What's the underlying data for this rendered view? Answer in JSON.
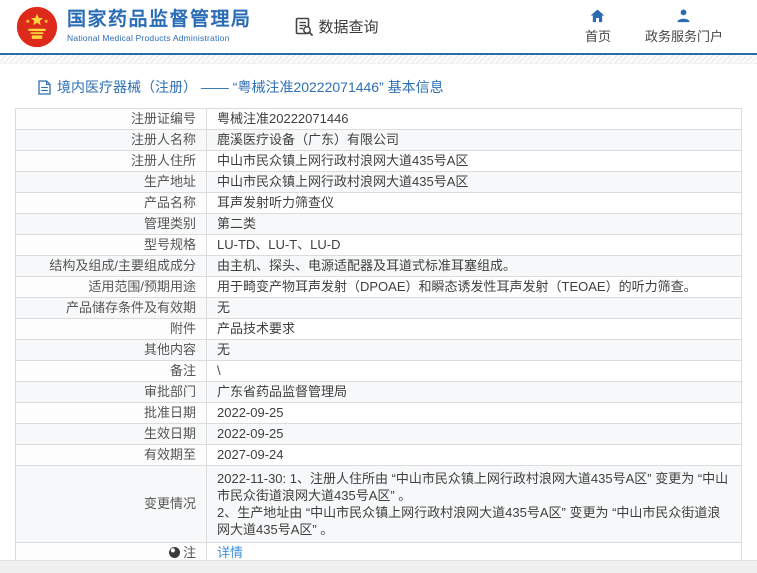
{
  "header": {
    "title_cn": "国家药品监督管理局",
    "title_en": "National Medical Products Administration",
    "data_query_label": "数据查询",
    "nav": {
      "home": "首页",
      "portal": "政务服务门户"
    }
  },
  "breadcrumb": {
    "text": "境内医疗器械（注册） —— “粤械注准20222071446” 基本信息"
  },
  "table": {
    "rows": [
      {
        "label": "注册证编号",
        "value": "粤械注准20222071446"
      },
      {
        "label": "注册人名称",
        "value": "鹿溪医疗设备（广东）有限公司"
      },
      {
        "label": "注册人住所",
        "value": "中山市民众镇上网行政村浪网大道435号A区"
      },
      {
        "label": "生产地址",
        "value": "中山市民众镇上网行政村浪网大道435号A区"
      },
      {
        "label": "产品名称",
        "value": "耳声发射听力筛查仪"
      },
      {
        "label": "管理类别",
        "value": "第二类"
      },
      {
        "label": "型号规格",
        "value": "LU-TD、LU-T、LU-D"
      },
      {
        "label": "结构及组成/主要组成成分",
        "value": "由主机、探头、电源适配器及耳道式标准耳塞组成。"
      },
      {
        "label": "适用范围/预期用途",
        "value": "用于畸变产物耳声发射（DPOAE）和瞬态诱发性耳声发射（TEOAE）的听力筛查。"
      },
      {
        "label": "产品储存条件及有效期",
        "value": "无"
      },
      {
        "label": "附件",
        "value": "产品技术要求"
      },
      {
        "label": "其他内容",
        "value": "无"
      },
      {
        "label": "备注",
        "value": "\\"
      },
      {
        "label": "审批部门",
        "value": "广东省药品监督管理局"
      },
      {
        "label": "批准日期",
        "value": "2022-09-25"
      },
      {
        "label": "生效日期",
        "value": "2022-09-25"
      },
      {
        "label": "有效期至",
        "value": "2027-09-24"
      },
      {
        "label": "变更情况",
        "multiline": true,
        "value": "2022-11-30: 1、注册人住所由 “中山市民众镇上网行政村浪网大道435号A区” 变更为 “中山市民众街道浪网大道435号A区” 。\n2、生产地址由 “中山市民众镇上网行政村浪网大道435号A区” 变更为 “中山市民众街道浪网大道435号A区” 。"
      },
      {
        "label": "注",
        "label_icon": "note-icon",
        "value": "详情",
        "link": true
      }
    ]
  },
  "colors": {
    "accent_blue": "#2a6cb5",
    "line_blue": "#2470a8",
    "link_blue": "#3f8fdd",
    "emblem_red": "#dd2a1b",
    "emblem_gold": "#ffd83d",
    "border_gray": "#dcdcdc",
    "row_alt_gray": "#f7f8f9",
    "footer_gray": "#f0f0f1"
  }
}
